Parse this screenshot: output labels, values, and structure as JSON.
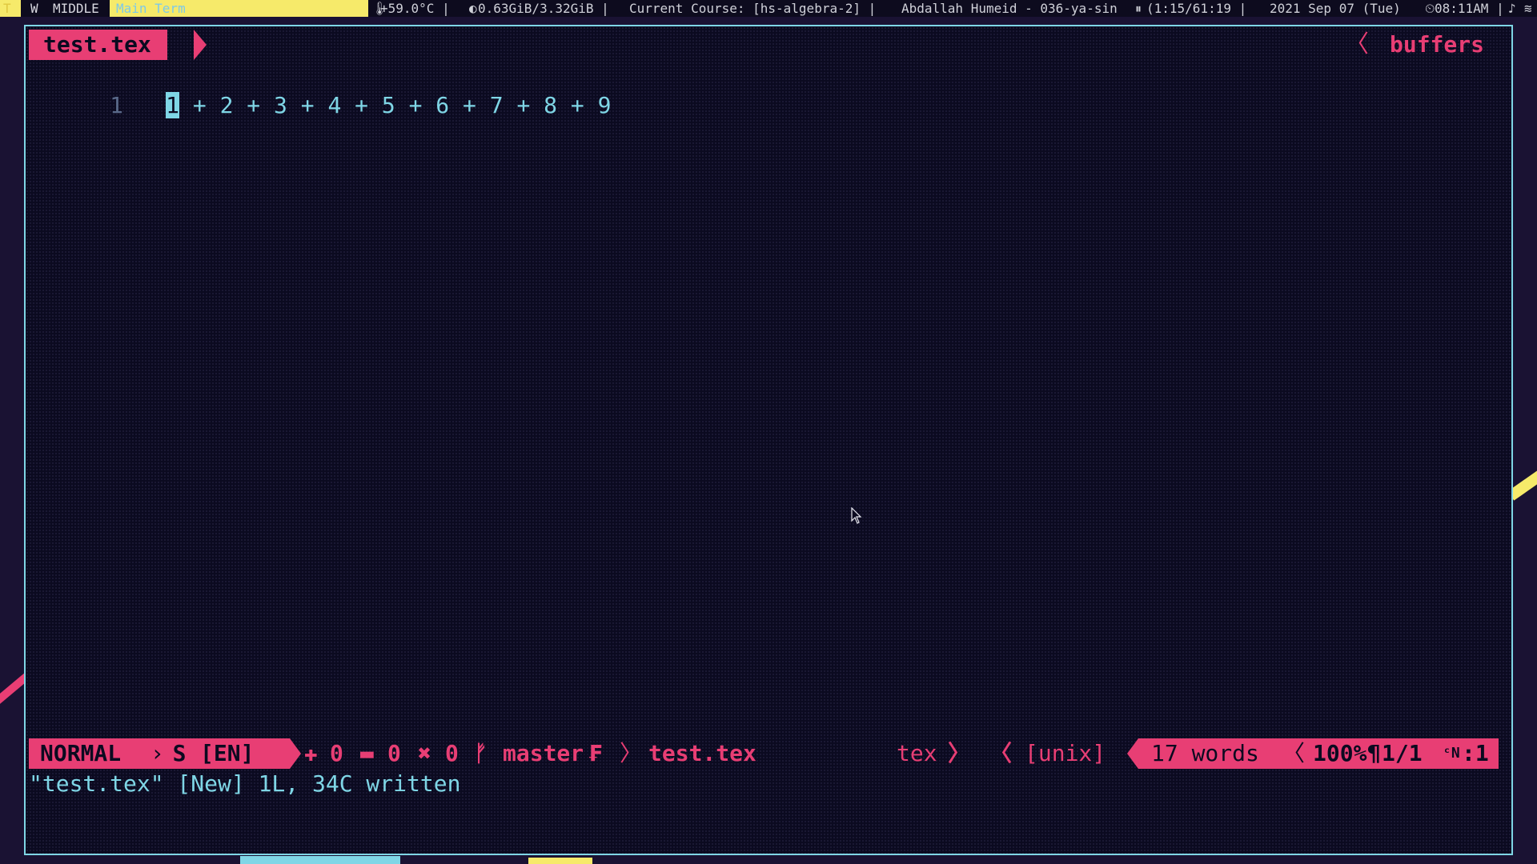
{
  "topbar": {
    "workspace": "T",
    "window": "W",
    "layout": "MIDDLE",
    "title": "Main Term",
    "temperature": "+59.0°C |",
    "memory": "0.63GiB/3.32GiB |",
    "course": "Current Course: [hs-algebra-2] |",
    "media": "Abdallah Humeid - 036-ya-sin",
    "media_time": "(1:15/61:19 |",
    "date": "2021 Sep 07 (Tue)",
    "time": "08:11AM |"
  },
  "editor": {
    "filename_tab": "test.tex",
    "buffers_label": "buffers",
    "line_number": "1",
    "cursor_char": "1",
    "line_rest": " + 2 + 3 + 4 + 5 + 6 + 7 + 8 + 9"
  },
  "statusline": {
    "mode": "NORMAL",
    "lang": "[EN]",
    "added": "0",
    "removed": "0",
    "errors": "0",
    "branch": "master",
    "file": "test.tex",
    "filetype": "tex",
    "format": "[unix]",
    "words": "17 words",
    "percent": "100%",
    "position": "1/1",
    "column": ":1"
  },
  "cmdline": "\"test.tex\" [New] 1L, 34C written",
  "colors": {
    "accent_pink": "#e83e74",
    "accent_cyan": "#7fd6e6",
    "accent_yellow": "#f6ea6a",
    "background": "#0b0a20"
  }
}
